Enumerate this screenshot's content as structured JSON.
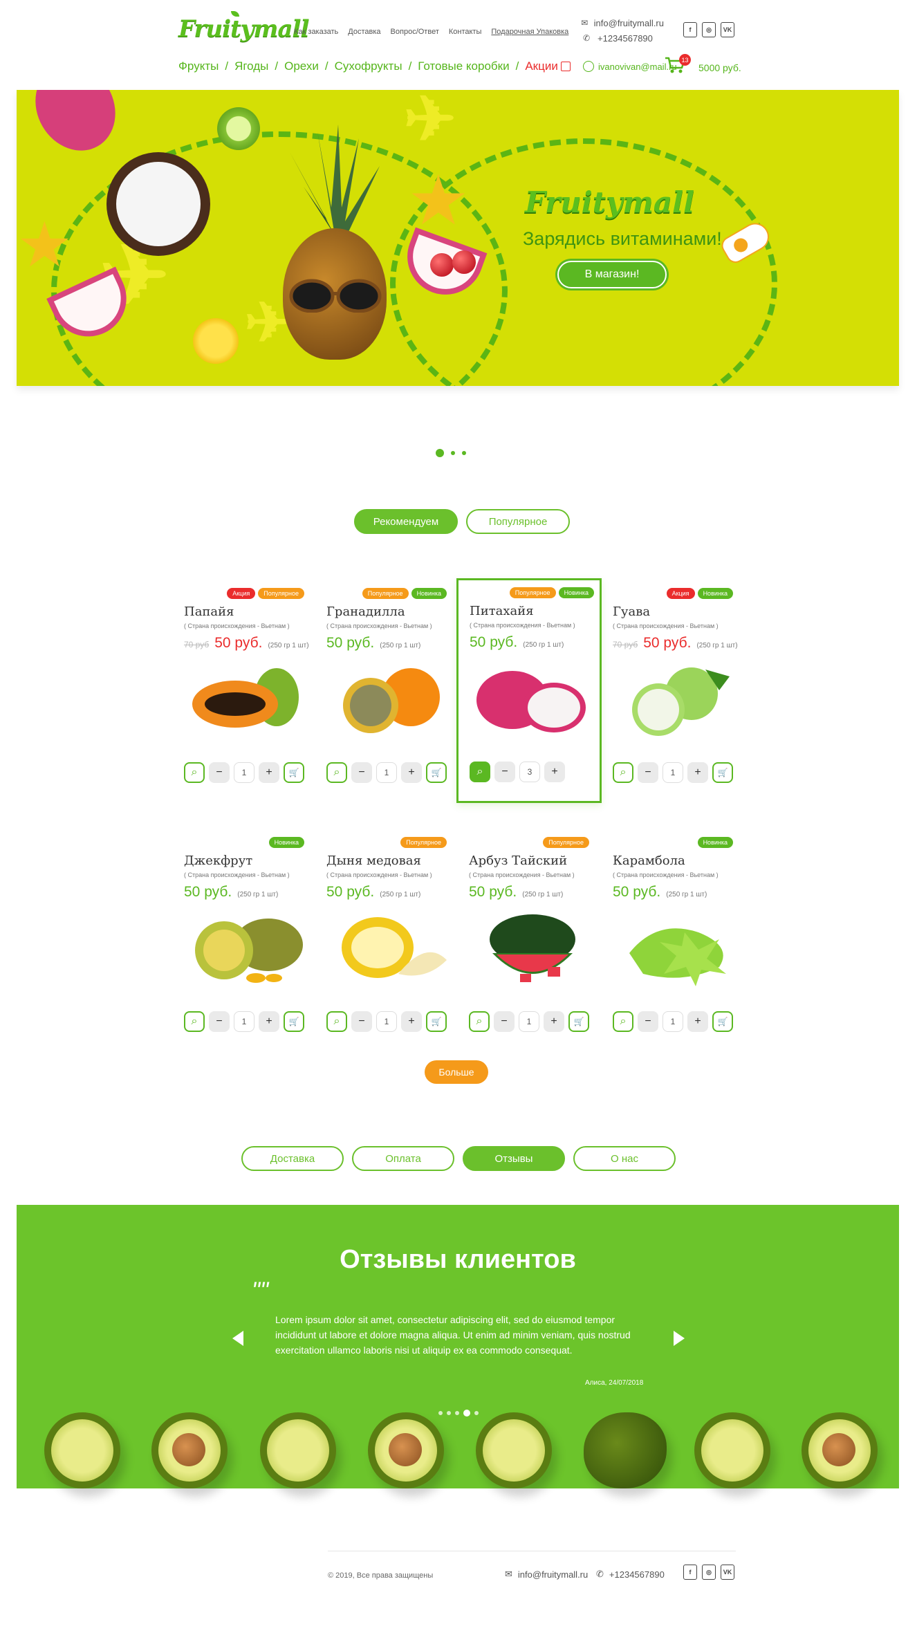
{
  "brand": {
    "name": "Fruitymall"
  },
  "topnav": [
    "Как заказать",
    "Доставка",
    "Вопрос/Ответ",
    "Контакты",
    "Подарочная Упаковка"
  ],
  "contacts": {
    "email": "info@fruitymall.ru",
    "phone": "+1234567890"
  },
  "socials": [
    "f",
    "◎",
    "VK"
  ],
  "catnav": {
    "items": [
      "Фрукты",
      "Ягоды",
      "Орехи",
      "Сухофрукты",
      "Готовые коробки"
    ],
    "sale": "Акции"
  },
  "user": {
    "email": "ivanovivan@mail.ru"
  },
  "cart": {
    "count": "13",
    "total": "5000 руб."
  },
  "hero": {
    "logo": "Fruitymall",
    "tagline": "Зарядись витаминами!",
    "button": "В магазин!"
  },
  "product_tabs": [
    "Рекомендуем",
    "Популярное"
  ],
  "badge_labels": {
    "sale": "Акция",
    "popular": "Популярное",
    "new": "Новинка"
  },
  "products": [
    {
      "name": "Папайя",
      "origin": "( Страна происхождения  - Вьетнам )",
      "old_price": "70 руб",
      "price": "50 руб.",
      "weight": "(250 гр 1 шт)",
      "qty": "1",
      "badges": [
        "sale",
        "popular"
      ]
    },
    {
      "name": "Гранадилла",
      "origin": "( Страна происхождения  - Вьетнам )",
      "old_price": "",
      "price": "50 руб.",
      "weight": "(250 гр 1 шт)",
      "qty": "1",
      "badges": [
        "popular",
        "new"
      ]
    },
    {
      "name": "Питахайя",
      "origin": "( Страна происхождения  - Вьетнам )",
      "old_price": "",
      "price": "50 руб.",
      "weight": "(250 гр 1 шт)",
      "qty": "3",
      "badges": [
        "popular",
        "new"
      ]
    },
    {
      "name": "Гуава",
      "origin": "( Страна происхождения  - Вьетнам )",
      "old_price": "70 руб",
      "price": "50 руб.",
      "weight": "(250 гр 1 шт)",
      "qty": "1",
      "badges": [
        "sale",
        "new"
      ]
    },
    {
      "name": "Джекфрут",
      "origin": "( Страна происхождения  - Вьетнам )",
      "old_price": "",
      "price": "50 руб.",
      "weight": "(250 гр 1 шт)",
      "qty": "1",
      "badges": [
        "new"
      ]
    },
    {
      "name": "Дыня медовая",
      "origin": "( Страна происхождения  - Вьетнам )",
      "old_price": "",
      "price": "50 руб.",
      "weight": "(250 гр 1 шт)",
      "qty": "1",
      "badges": [
        "popular"
      ]
    },
    {
      "name": "Арбуз Тайский",
      "origin": "( Страна происхождения  - Вьетнам )",
      "old_price": "",
      "price": "50 руб.",
      "weight": "(250 гр 1 шт)",
      "qty": "1",
      "badges": [
        "popular"
      ]
    },
    {
      "name": "Карамбола",
      "origin": "( Страна происхождения  - Вьетнам )",
      "old_price": "",
      "price": "50 руб.",
      "weight": "(250 гр 1 шт)",
      "qty": "1",
      "badges": [
        "new"
      ]
    }
  ],
  "more_button": "Больше",
  "info_tabs": [
    "Доставка",
    "Оплата",
    "Отзывы",
    "О нас"
  ],
  "reviews": {
    "title": "Отзывы клиентов",
    "quote_mark": "\"\"",
    "text": "Lorem ipsum dolor sit amet, consectetur adipiscing elit, sed do eiusmod tempor incididunt ut labore et dolore magna aliqua. Ut enim ad minim veniam, quis nostrud exercitation ullamco laboris nisi ut aliquip ex ea commodo consequat.",
    "author": "Алиса, 24/07/2018"
  },
  "footer": {
    "copyright": "© 2019, Все права защищены",
    "email": "info@fruitymall.ru",
    "phone": "+1234567890"
  },
  "colors": {
    "green": "#6cc42b",
    "hero_bg": "#d4df05",
    "orange": "#f59a1a",
    "red": "#ea2c2c"
  }
}
